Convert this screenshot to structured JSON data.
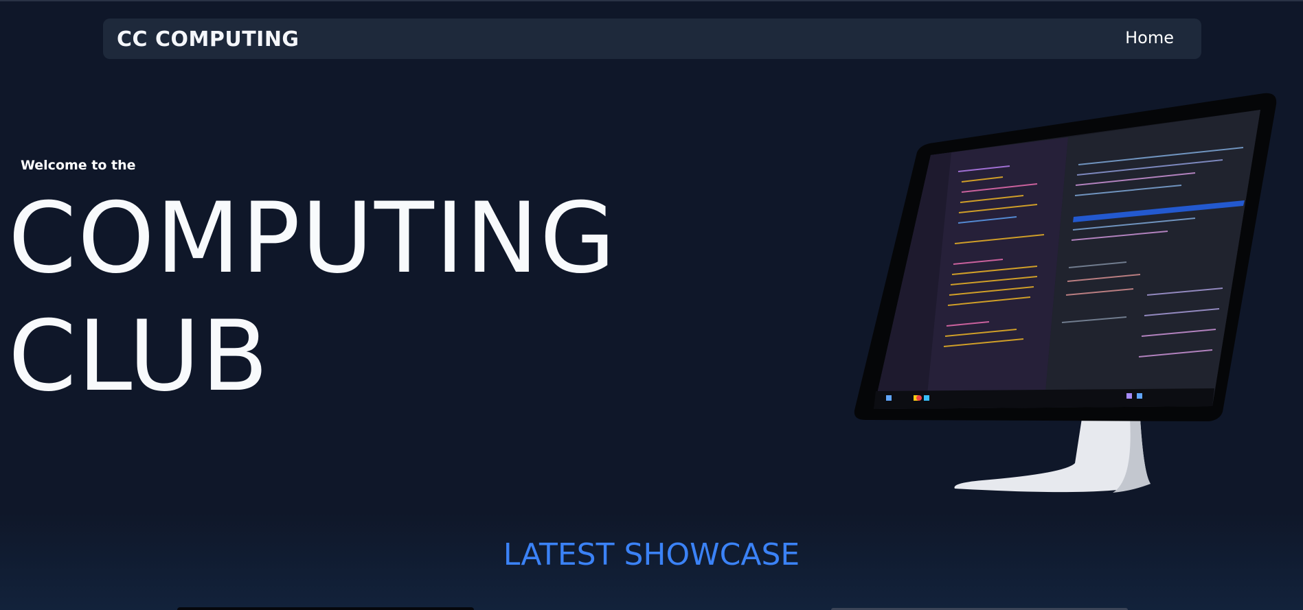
{
  "nav": {
    "brand": "CC COMPUTING",
    "links": [
      {
        "label": "Home"
      }
    ]
  },
  "hero": {
    "eyebrow": "Welcome to the",
    "title_line1": "COMPUTING",
    "title_line2": "CLUB"
  },
  "showcase": {
    "heading": "LATEST SHOWCASE"
  },
  "colors": {
    "background": "#0f1729",
    "navbar": "#1e293b",
    "accent": "#3b82f6",
    "text": "#f8fafc"
  },
  "icons": [
    "desktop-monitor-illustration"
  ]
}
